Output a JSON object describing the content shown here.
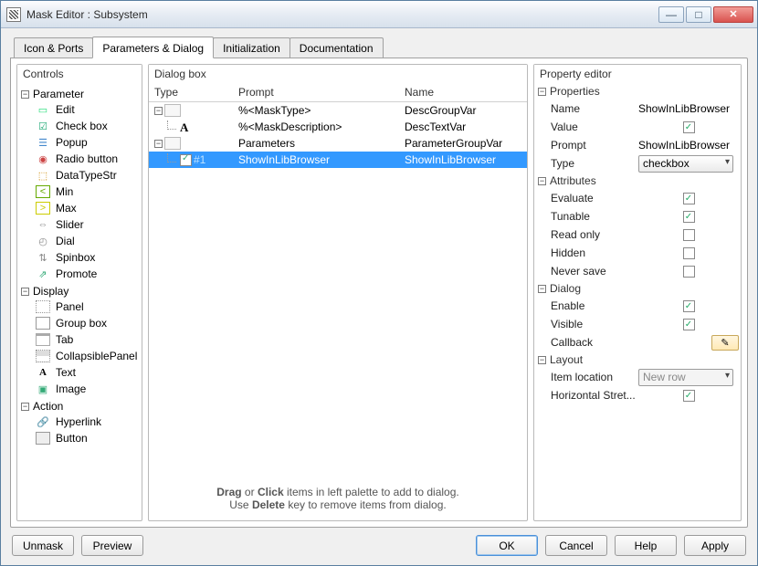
{
  "window": {
    "title": "Mask Editor : Subsystem"
  },
  "tabs": {
    "icon_ports": "Icon & Ports",
    "params_dialog": "Parameters & Dialog",
    "initialization": "Initialization",
    "documentation": "Documentation"
  },
  "controls_panel": {
    "header": "Controls",
    "groups": {
      "parameter": {
        "label": "Parameter",
        "items": {
          "edit": "Edit",
          "checkbox": "Check box",
          "popup": "Popup",
          "radio": "Radio button",
          "datatypestr": "DataTypeStr",
          "min": "Min",
          "max": "Max",
          "slider": "Slider",
          "dial": "Dial",
          "spinbox": "Spinbox",
          "promote": "Promote"
        }
      },
      "display": {
        "label": "Display",
        "items": {
          "panel": "Panel",
          "groupbox": "Group box",
          "tab": "Tab",
          "collapsible": "CollapsiblePanel",
          "text": "Text",
          "image": "Image"
        }
      },
      "action": {
        "label": "Action",
        "items": {
          "hyperlink": "Hyperlink",
          "button": "Button"
        }
      }
    }
  },
  "dialog_panel": {
    "header": "Dialog box",
    "cols": {
      "type": "Type",
      "prompt": "Prompt",
      "name": "Name"
    },
    "rows": [
      {
        "level": 0,
        "expand": "-",
        "icon": "box",
        "type": "",
        "prompt": "%<MaskType>",
        "name": "DescGroupVar"
      },
      {
        "level": 1,
        "icon": "txt",
        "type": "",
        "prompt": "%<MaskDescription>",
        "name": "DescTextVar"
      },
      {
        "level": 0,
        "expand": "-",
        "icon": "box",
        "type": "",
        "prompt": "Parameters",
        "name": "ParameterGroupVar"
      },
      {
        "level": 1,
        "icon": "cb",
        "type": "#1",
        "prompt": "ShowInLibBrowser",
        "name": "ShowInLibBrowser",
        "selected": true
      }
    ],
    "hint1": "Drag or Click items in left palette to add to dialog.",
    "hint2": "Use Delete key to remove items from dialog.",
    "hint_bold_drag": "Drag",
    "hint_bold_click": "Click",
    "hint_bold_delete": "Delete"
  },
  "property_panel": {
    "header": "Property editor",
    "sections": {
      "properties": {
        "label": "Properties",
        "rows": {
          "name": {
            "label": "Name",
            "value": "ShowInLibBrowser",
            "kind": "text"
          },
          "value": {
            "label": "Value",
            "checked": true,
            "kind": "check"
          },
          "prompt": {
            "label": "Prompt",
            "value": "ShowInLibBrowser",
            "kind": "text"
          },
          "type": {
            "label": "Type",
            "value": "checkbox",
            "kind": "select"
          }
        }
      },
      "attributes": {
        "label": "Attributes",
        "rows": {
          "evaluate": {
            "label": "Evaluate",
            "checked": true
          },
          "tunable": {
            "label": "Tunable",
            "checked": true
          },
          "readonly": {
            "label": "Read only",
            "checked": false
          },
          "hidden": {
            "label": "Hidden",
            "checked": false
          },
          "neversave": {
            "label": "Never save",
            "checked": false
          }
        }
      },
      "dialog": {
        "label": "Dialog",
        "rows": {
          "enable": {
            "label": "Enable",
            "checked": true
          },
          "visible": {
            "label": "Visible",
            "checked": true
          },
          "callback": {
            "label": "Callback",
            "kind": "edit"
          }
        }
      },
      "layout": {
        "label": "Layout",
        "rows": {
          "itemlocation": {
            "label": "Item location",
            "value": "New row",
            "kind": "select",
            "disabled": true
          },
          "hstretch": {
            "label": "Horizontal Stret...",
            "checked": true
          }
        }
      }
    }
  },
  "footer": {
    "unmask": "Unmask",
    "preview": "Preview",
    "ok": "OK",
    "cancel": "Cancel",
    "help": "Help",
    "apply": "Apply"
  }
}
